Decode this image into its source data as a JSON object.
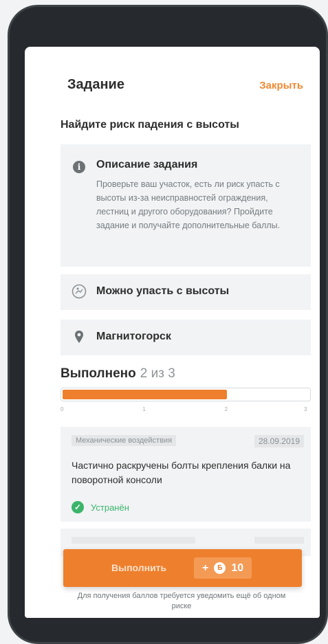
{
  "header": {
    "title": "Задание",
    "close_label": "Закрыть"
  },
  "task": {
    "title": "Найдите риск падения с высоты",
    "description_heading": "Описание задания",
    "description_text": "Проверьте ваш участок, есть ли риск упасть с высоты из-за неисправностей ограждения, лестниц и другого оборудования? Пройдите задание и получайте дополнительные баллы.",
    "hazard_label": "Можно упасть с высоты",
    "location_label": "Магнитогорск"
  },
  "progress": {
    "label": "Выполнено",
    "count_text": "2 из 3",
    "completed": 2,
    "total": 3,
    "ticks": [
      "0",
      "1",
      "2",
      "3"
    ],
    "fill_color": "#ee7f2d"
  },
  "issue": {
    "category": "Механические воздействия",
    "date": "28.09.2019",
    "text": "Частично раскручены болты крепления балки на поворотной консоли",
    "status": "Устранён",
    "status_color": "#3bb56a"
  },
  "action": {
    "button_label": "Выполнить",
    "bonus_prefix": "+",
    "bonus_value": "10",
    "note": "Для получения баллов требуется уведомить ещё об одном риске"
  },
  "icons": {
    "info": "info-icon",
    "fall": "fall-hazard-icon",
    "location": "location-pin-icon",
    "status": "check-circle-icon",
    "coin": "coin-icon"
  },
  "colors": {
    "accent": "#ee7f2d",
    "success": "#3bb56a"
  }
}
